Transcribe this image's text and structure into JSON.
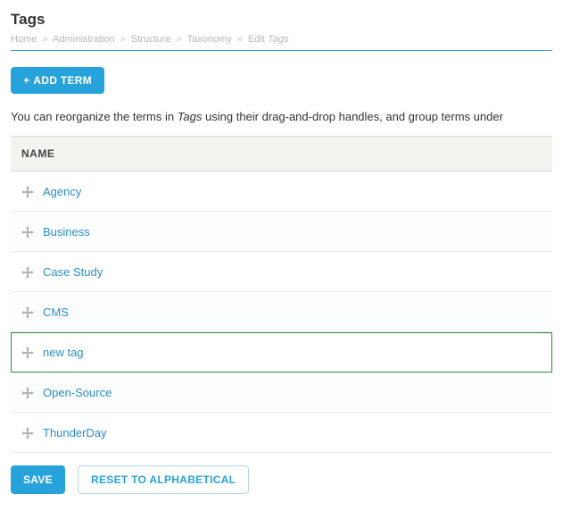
{
  "page_title": "Tags",
  "breadcrumb": {
    "items": [
      {
        "label": "Home"
      },
      {
        "label": "Administration"
      },
      {
        "label": "Structure"
      },
      {
        "label": "Taxonomy"
      }
    ],
    "tail_prefix": "Edit",
    "tail_em": "Tags"
  },
  "buttons": {
    "add_term": "ADD TERM",
    "save": "SAVE",
    "reset": "RESET TO ALPHABETICAL"
  },
  "help": {
    "prefix": "You can reorganize the terms in ",
    "em": "Tags",
    "suffix": " using their drag-and-drop handles, and group terms under"
  },
  "table": {
    "header": "NAME",
    "rows": [
      {
        "label": "Agency",
        "alt": false,
        "highlight": false
      },
      {
        "label": "Business",
        "alt": true,
        "highlight": false
      },
      {
        "label": "Case Study",
        "alt": false,
        "highlight": false
      },
      {
        "label": "CMS",
        "alt": true,
        "highlight": false
      },
      {
        "label": "new tag",
        "alt": false,
        "highlight": true
      },
      {
        "label": "Open-Source",
        "alt": true,
        "highlight": false
      },
      {
        "label": "ThunderDay",
        "alt": false,
        "highlight": false
      }
    ]
  }
}
